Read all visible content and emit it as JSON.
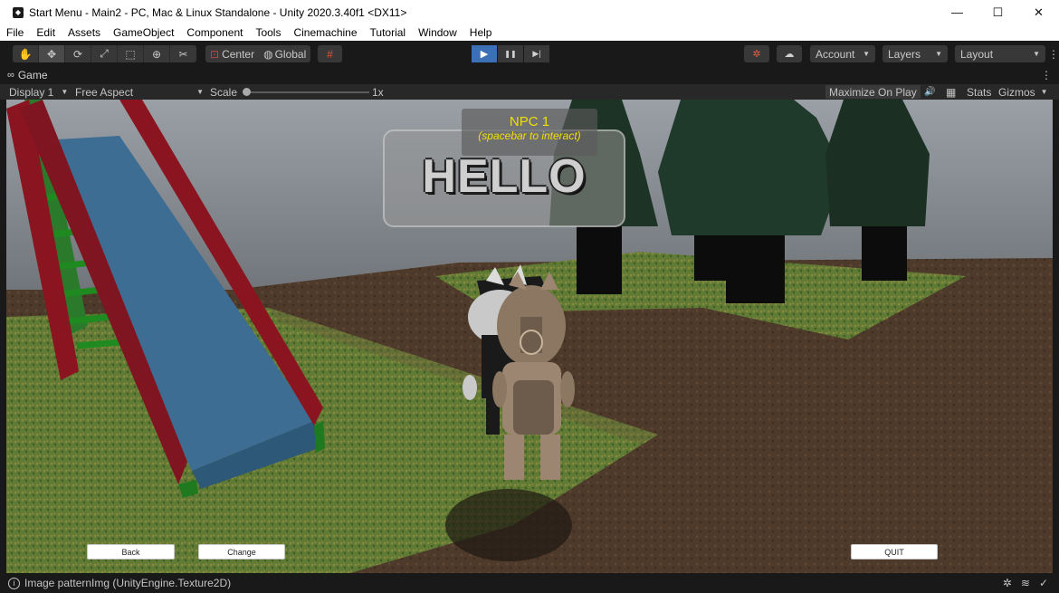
{
  "window": {
    "title": "Start Menu - Main2 - PC, Mac & Linux Standalone - Unity 2020.3.40f1 <DX11>",
    "app_icon": "unity-icon",
    "controls": {
      "minimize": "—",
      "maximize": "☐",
      "close": "✕"
    }
  },
  "menu": [
    "File",
    "Edit",
    "Assets",
    "GameObject",
    "Component",
    "Tools",
    "Cinemachine",
    "Tutorial",
    "Window",
    "Help"
  ],
  "toolbar": {
    "tools": [
      {
        "name": "hand-tool-icon",
        "glyph": "✋"
      },
      {
        "name": "move-tool-icon",
        "glyph": "✥"
      },
      {
        "name": "rotate-tool-icon",
        "glyph": "⟳"
      },
      {
        "name": "scale-tool-icon",
        "glyph": "⤢"
      },
      {
        "name": "rect-tool-icon",
        "glyph": "⬚"
      },
      {
        "name": "transform-tool-icon",
        "glyph": "⊕"
      },
      {
        "name": "custom-tool-icon",
        "glyph": "✂"
      }
    ],
    "pivot_mode": "Center",
    "pivot_rotation": "Global",
    "grid_icon": "#",
    "play_icon": "▶",
    "pause_icon": "❚❚",
    "step_icon": "▶|",
    "collab_icon": "✲",
    "cloud_icon": "☁",
    "account": "Account",
    "layers": "Layers",
    "layout": "Layout",
    "dropdown_arrow": "▼",
    "more_icon": "⋮"
  },
  "game_tab": {
    "label": "Game",
    "icon": "∞",
    "more_icon": "⋮",
    "display": "Display 1",
    "aspect": "Free Aspect",
    "scale_label": "Scale",
    "scale_value": "1x",
    "scale_fraction": 0.0,
    "maximize_on_play": "Maximize On Play",
    "mute_icon": "🔊",
    "stats_icon": "▦",
    "stats": "Stats",
    "gizmos": "Gizmos",
    "arrow": "▼"
  },
  "scene": {
    "npc_name": "NPC 1",
    "npc_hint": "(spacebar to interact)",
    "speech": "HELLO",
    "buttons": {
      "back": "Back",
      "change": "Change",
      "quit": "QUIT"
    },
    "colors": {
      "sky": "#8a8f94",
      "grass": "#5c7a33",
      "dirt": "#4f3a2b",
      "slide_blue": "#3e6d94",
      "slide_red": "#8a1520",
      "ladder_green": "#1f8a1f",
      "npc_text": "#f0e000"
    }
  },
  "status": {
    "icon": "i",
    "message": "Image patternImg (UnityEngine.Texture2D)",
    "icons": [
      "✲",
      "≋",
      "✓"
    ]
  }
}
